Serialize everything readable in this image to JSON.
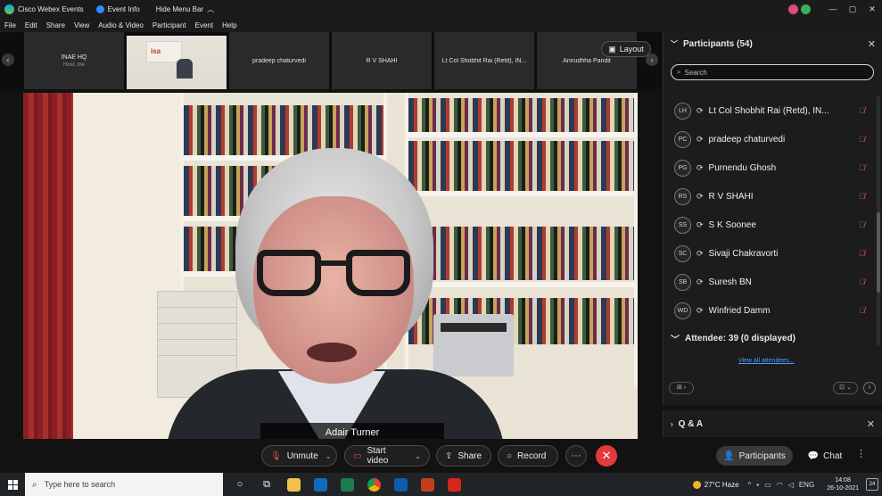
{
  "titlebar": {
    "app_title": "Cisco Webex Events",
    "event_info": "Event Info",
    "hide_menu": "Hide Menu Bar",
    "avatar_a": "",
    "avatar_b": "",
    "minimize": "—",
    "maximize": "▢",
    "close": "✕"
  },
  "menubar": {
    "items": [
      "File",
      "Edit",
      "Share",
      "View",
      "Audio & Video",
      "Participant",
      "Event",
      "Help"
    ]
  },
  "thumbnails": [
    {
      "name": "INAE HQ",
      "role": "Host, me"
    },
    {
      "name": "",
      "role": ""
    },
    {
      "name": "pradeep chaturvedi",
      "role": ""
    },
    {
      "name": "R V SHAHI",
      "role": ""
    },
    {
      "name": "Lt Col Shobhit Rai (Retd), IN...",
      "role": ""
    },
    {
      "name": "Anirudhha Pandit",
      "role": ""
    }
  ],
  "thumb_video_banner": "isa",
  "layout_label": "Layout",
  "speaker_name": "Adair Turner",
  "controls": {
    "unmute": "Unmute",
    "start_video": "Start video",
    "share": "Share",
    "record": "Record",
    "more": "···",
    "end": "✕",
    "participants": "Participants",
    "chat": "Chat",
    "overflow": "⋮"
  },
  "panel": {
    "title": "Participants (54)",
    "close": "✕",
    "search_placeholder": "Search",
    "participants": [
      {
        "initials": "LH",
        "name": "Lt Col Shobhit Rai (Retd), IN..."
      },
      {
        "initials": "PC",
        "name": "pradeep chaturvedi"
      },
      {
        "initials": "PG",
        "name": "Purnendu Ghosh"
      },
      {
        "initials": "RS",
        "name": "R V SHAHI"
      },
      {
        "initials": "SS",
        "name": "S K Soonee"
      },
      {
        "initials": "SC",
        "name": "Sivaji Chakravorti"
      },
      {
        "initials": "SB",
        "name": "Suresh BN"
      },
      {
        "initials": "WD",
        "name": "Winfried Damm"
      }
    ],
    "attendee": "Attendee: 39 (0 displayed)",
    "view_all": "View all attendees..."
  },
  "qa": {
    "title": "Q & A",
    "close": "✕"
  },
  "taskbar": {
    "search_placeholder": "Type here to search",
    "weather": "27°C  Haze",
    "lang": "ENG",
    "time": "14:08",
    "date": "26-10-2021",
    "notifications": "24"
  },
  "colors": {
    "accent_link": "#4f9cff",
    "end_call": "#e33b3b",
    "muted_mic": "#e0554f"
  }
}
